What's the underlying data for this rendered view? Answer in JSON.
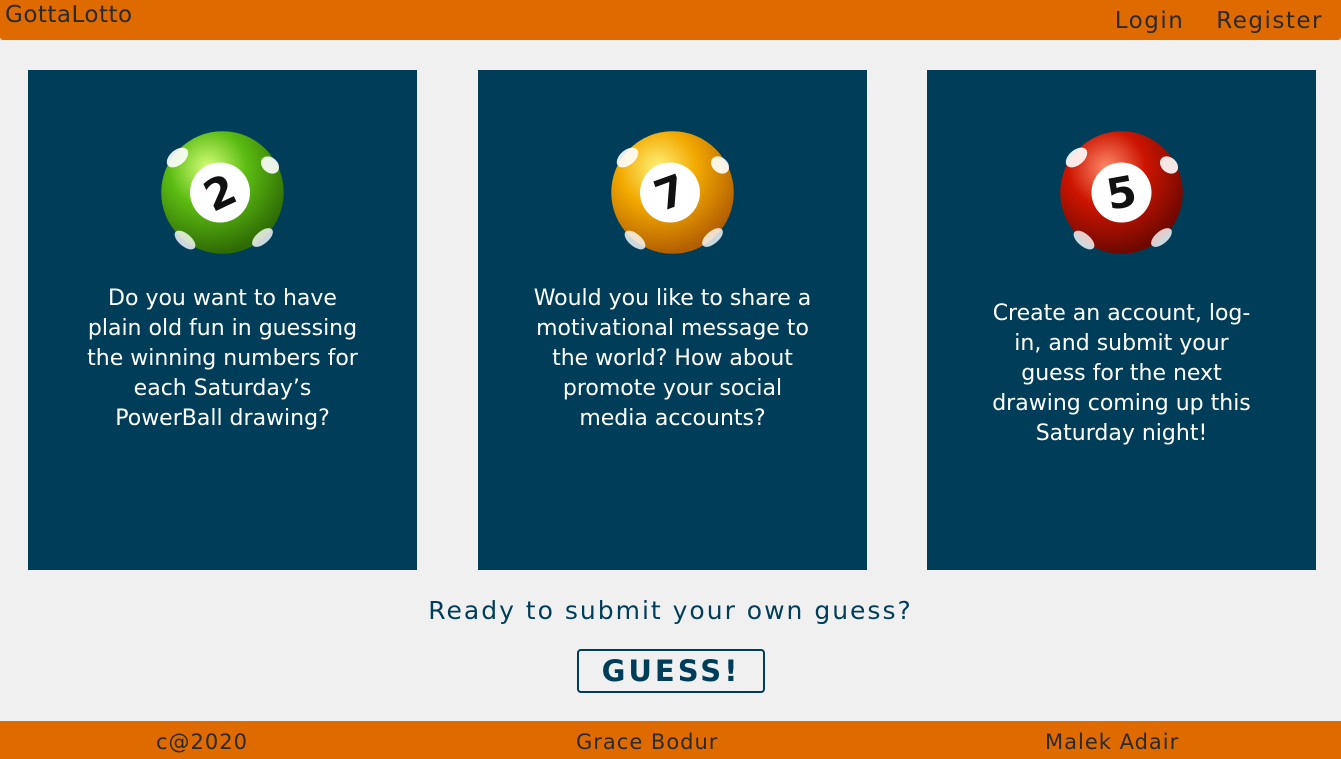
{
  "header": {
    "brand": "GottaLotto",
    "nav": {
      "login": "Login",
      "register": "Register"
    }
  },
  "cards": [
    {
      "ball_number": "2",
      "ball_color": "#5cbc12",
      "text": "Do you want to have plain old fun in guessing the winning numbers for each Saturday’s PowerBall drawing?"
    },
    {
      "ball_number": "7",
      "ball_color": "#f2a900",
      "text": "Would you like to share a motivational message to the world? How about promote your social media accounts?"
    },
    {
      "ball_number": "5",
      "ball_color": "#cc1500",
      "text": "Create an account, log-in, and submit your guess for the next drawing coming up this Saturday night!"
    }
  ],
  "cta": {
    "prompt": "Ready to submit your own guess?",
    "button": "GUESS!"
  },
  "footer": {
    "copyright": "c@2020",
    "author1": "Grace Bodur",
    "author2": "Malek Adair"
  },
  "colors": {
    "accent": "#de6a00",
    "card_bg": "#003d59",
    "page_bg": "#f0f0f0"
  }
}
